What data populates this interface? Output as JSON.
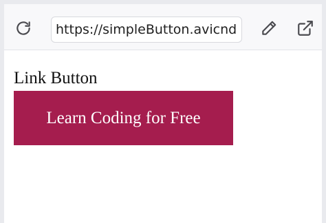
{
  "browser": {
    "url": "https://simpleButton.avicndugu",
    "icons": {
      "reload": "reload-icon",
      "edit": "pencil-icon",
      "external": "external-link-icon"
    }
  },
  "page": {
    "heading": "Link Button",
    "button_label": "Learn Coding for Free",
    "button_color": "#a51d4e",
    "button_text_color": "#ffffff"
  }
}
